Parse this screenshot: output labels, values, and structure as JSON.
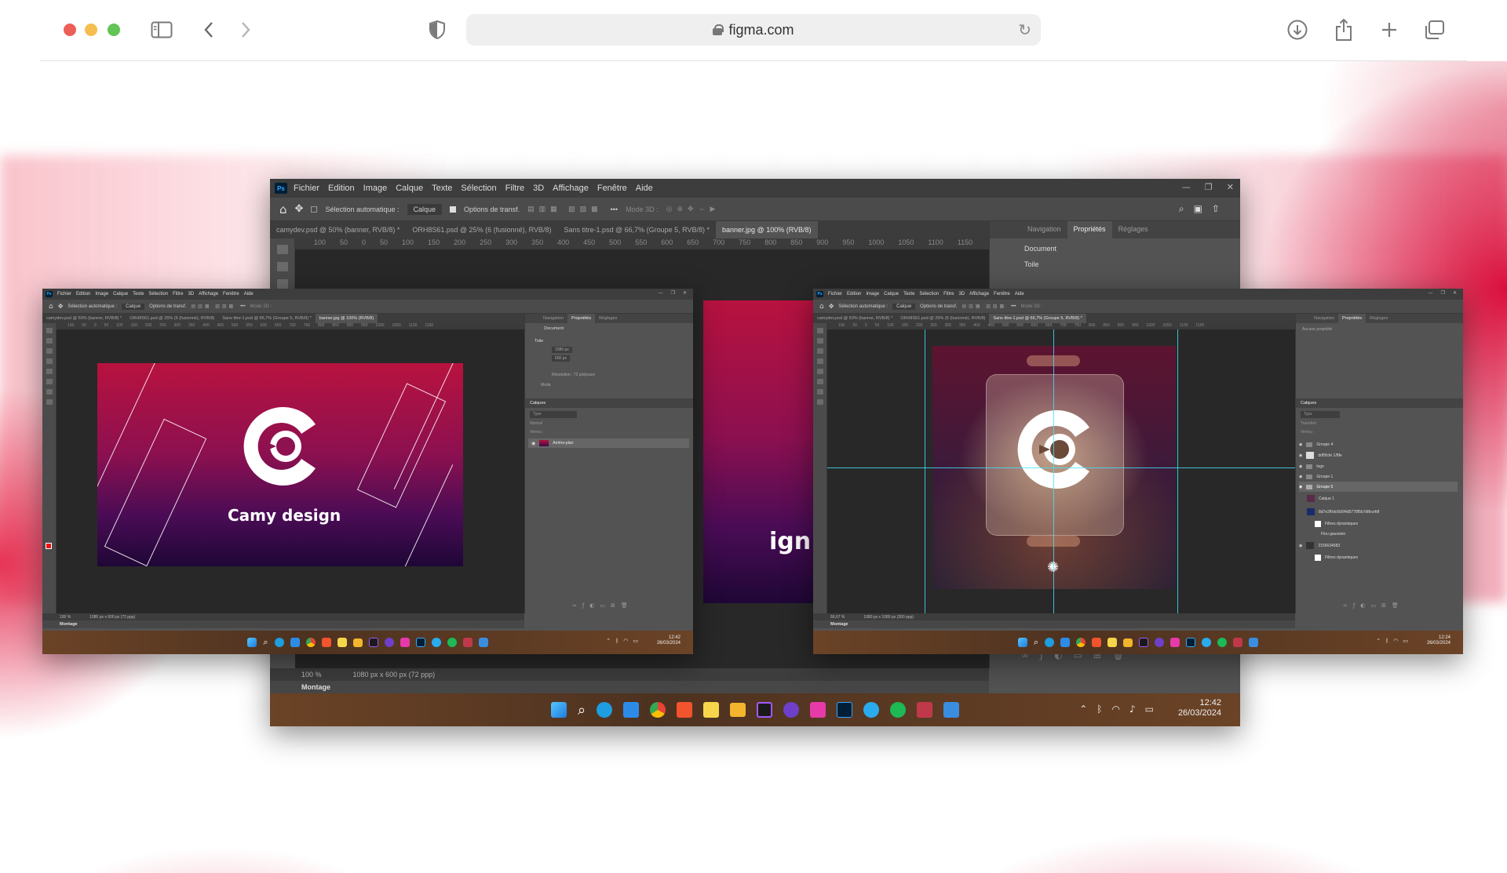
{
  "browser": {
    "url": "figma.com",
    "icons": [
      "sidebar-toggle-icon",
      "back-chevron-icon",
      "forward-chevron-icon",
      "privacy-shield-icon",
      "reload-icon",
      "download-icon",
      "share-icon",
      "new-tab-plus-icon",
      "tabs-overview-icon"
    ]
  },
  "photoshop": {
    "menu": [
      "Fichier",
      "Edition",
      "Image",
      "Calque",
      "Texte",
      "Sélection",
      "Filtre",
      "3D",
      "Affichage",
      "Fenêtre",
      "Aide"
    ],
    "options": {
      "auto_select": "Sélection automatique :",
      "auto_select_target": "Calque",
      "transform_options": "Options de transf.",
      "mode_3d": "Mode 3D :"
    },
    "tabs": [
      "camydev.psd @ 50% (banner, RVB/8) *",
      "ORH8S61.psd @ 25% (6 (fusionné), RVB/8)",
      "Sans titre-1.psd @ 66,7% (Groupe 5, RVB/8) *",
      "banner.jpg @ 100% (RVB/8)"
    ],
    "ruler_ticks": [
      "100",
      "50",
      "0",
      "50",
      "100",
      "150",
      "200",
      "250",
      "300",
      "350",
      "400",
      "450",
      "500",
      "550",
      "600",
      "650",
      "700",
      "750",
      "800",
      "850",
      "900",
      "950",
      "1000",
      "1050",
      "1100",
      "1150"
    ],
    "panel_tabs": [
      "Navigation",
      "Propriétés",
      "Réglages"
    ],
    "properties": {
      "document_label": "Document",
      "canvas_section": "Toile",
      "width": "1080 px",
      "height": "600 px",
      "resolution": "Résolution : 72 px/pouce",
      "mode": "Mode"
    },
    "layers_title": "Calques",
    "layers_search": "Type",
    "layer_mode": "Normal",
    "layer_opacity_label": "Opacité :",
    "layer_opacity": "100 %",
    "layer_fill_label": "Fond :",
    "layer_fill": "100 %",
    "layer_lock_label": "Verrou :",
    "background_layer": "Arrière-plan",
    "status_zoom": "100 %",
    "status_doc": "1080 px x 600 px (72 ppp)",
    "montage": "Montage",
    "clock_time": "12:42",
    "clock_date": "26/03/2024"
  },
  "left_window": {
    "status_zoom": "100 %",
    "status_doc": "1080 px x 600 px (72 ppp)",
    "banner_title": "Camy design"
  },
  "back_window": {
    "banner_fragment": "ign"
  },
  "right_window": {
    "tab_active": "Sans titre-1.psd @ 66,7% (Groupe 5, RVB/8) *",
    "properties_empty": "Aucune propriété",
    "layer_mode": "Transfert",
    "layers": [
      "Groupe 4",
      "ddf5fcfe 1/8fe",
      "logo",
      "Groupe 1",
      "Groupe 5",
      "Calque 1",
      "8d7e2f0dc6b5f4d5778f5b7dfbcefdf",
      "Filtres dynamiques",
      "Flou gaussien",
      "2156634683",
      "Filtres dynamiques"
    ],
    "status_zoom": "66,67 %",
    "status_doc": "1080 px x 1080 px (300 ppp)",
    "clock_time": "12:24",
    "clock_date": "26/03/2024"
  },
  "colors": {
    "accent_red": "#d7003a",
    "ps_blue": "#31a8ff",
    "ps_dark": "#001e36",
    "guide_cyan": "#3fe6ff"
  }
}
